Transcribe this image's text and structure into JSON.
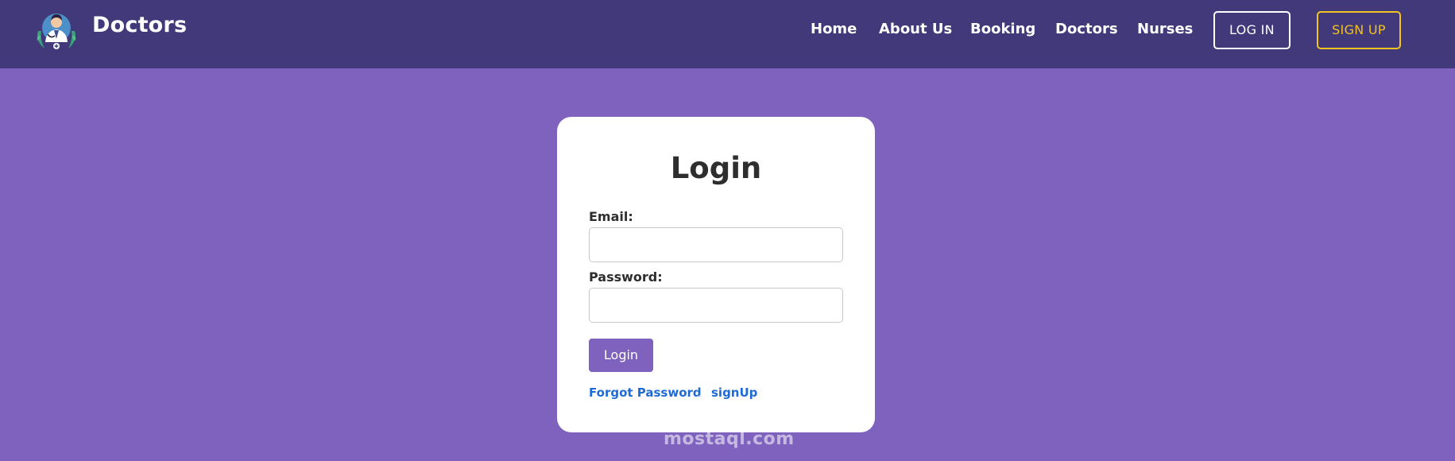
{
  "header": {
    "brand_name": "Doctors",
    "nav": [
      {
        "label": "Home"
      },
      {
        "label": "About Us"
      },
      {
        "label": "Booking"
      },
      {
        "label": "Doctors"
      },
      {
        "label": "Nurses"
      }
    ],
    "login_label": "LOG IN",
    "signup_label": "SIGN UP"
  },
  "login_form": {
    "title": "Login",
    "email_label": "Email:",
    "email_value": "",
    "password_label": "Password:",
    "password_value": "",
    "submit_label": "Login",
    "forgot_label": "Forgot Password",
    "signup_label": "signUp"
  },
  "watermark": {
    "text": "mostaql.com"
  },
  "colors": {
    "header_bg": "#413979",
    "page_bg": "#7e62bd",
    "accent": "#7e62bd",
    "signup_accent": "#f2c322",
    "link": "#1e6bd6"
  },
  "icons": {
    "logo": "doctor-logo-icon"
  }
}
